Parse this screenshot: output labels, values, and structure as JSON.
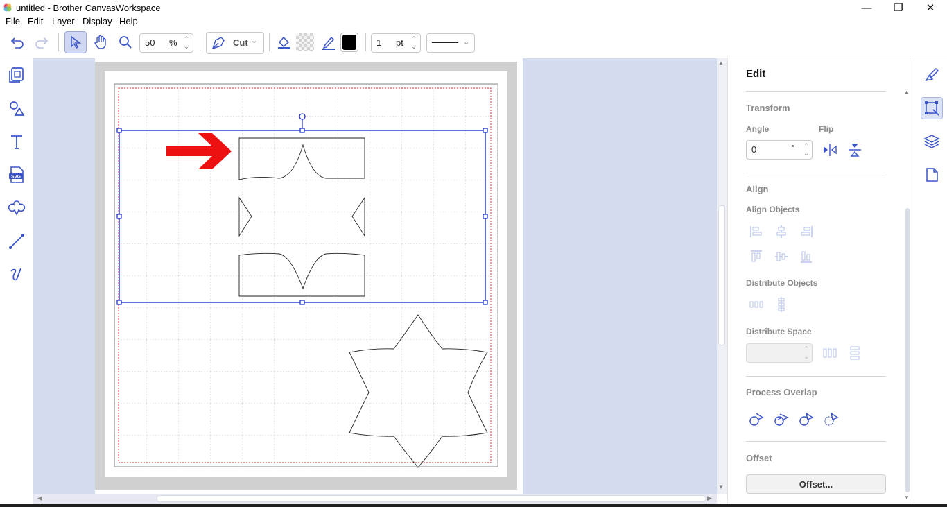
{
  "window": {
    "title": "untitled - Brother CanvasWorkspace",
    "minimize": "—",
    "maximize": "❐",
    "close": "✕"
  },
  "menu": [
    "File",
    "Edit",
    "Layer",
    "Display",
    "Help"
  ],
  "toolbar": {
    "zoom_value": "50",
    "zoom_unit": "%",
    "cut_mode": "Cut",
    "line_width": "1",
    "line_unit": "pt",
    "line_color": "#000000",
    "accent": "#3b55c9"
  },
  "left_tools": [
    "pages-icon",
    "shapes-icon",
    "text-icon",
    "svg-import-icon",
    "pattern-icon",
    "line-icon",
    "freehand-icon"
  ],
  "right_panel": {
    "title": "Edit",
    "transform": {
      "heading": "Transform",
      "angle_label": "Angle",
      "flip_label": "Flip",
      "angle_value": "0",
      "angle_unit": "°"
    },
    "align": {
      "heading": "Align",
      "align_objects": "Align Objects",
      "distribute_objects": "Distribute Objects",
      "distribute_space": "Distribute Space"
    },
    "process_overlap": {
      "heading": "Process Overlap"
    },
    "offset": {
      "heading": "Offset",
      "button": "Offset..."
    }
  },
  "right_tabs": [
    "paint-brush-icon",
    "edit-transform-icon",
    "layers-icon",
    "page-icon"
  ]
}
